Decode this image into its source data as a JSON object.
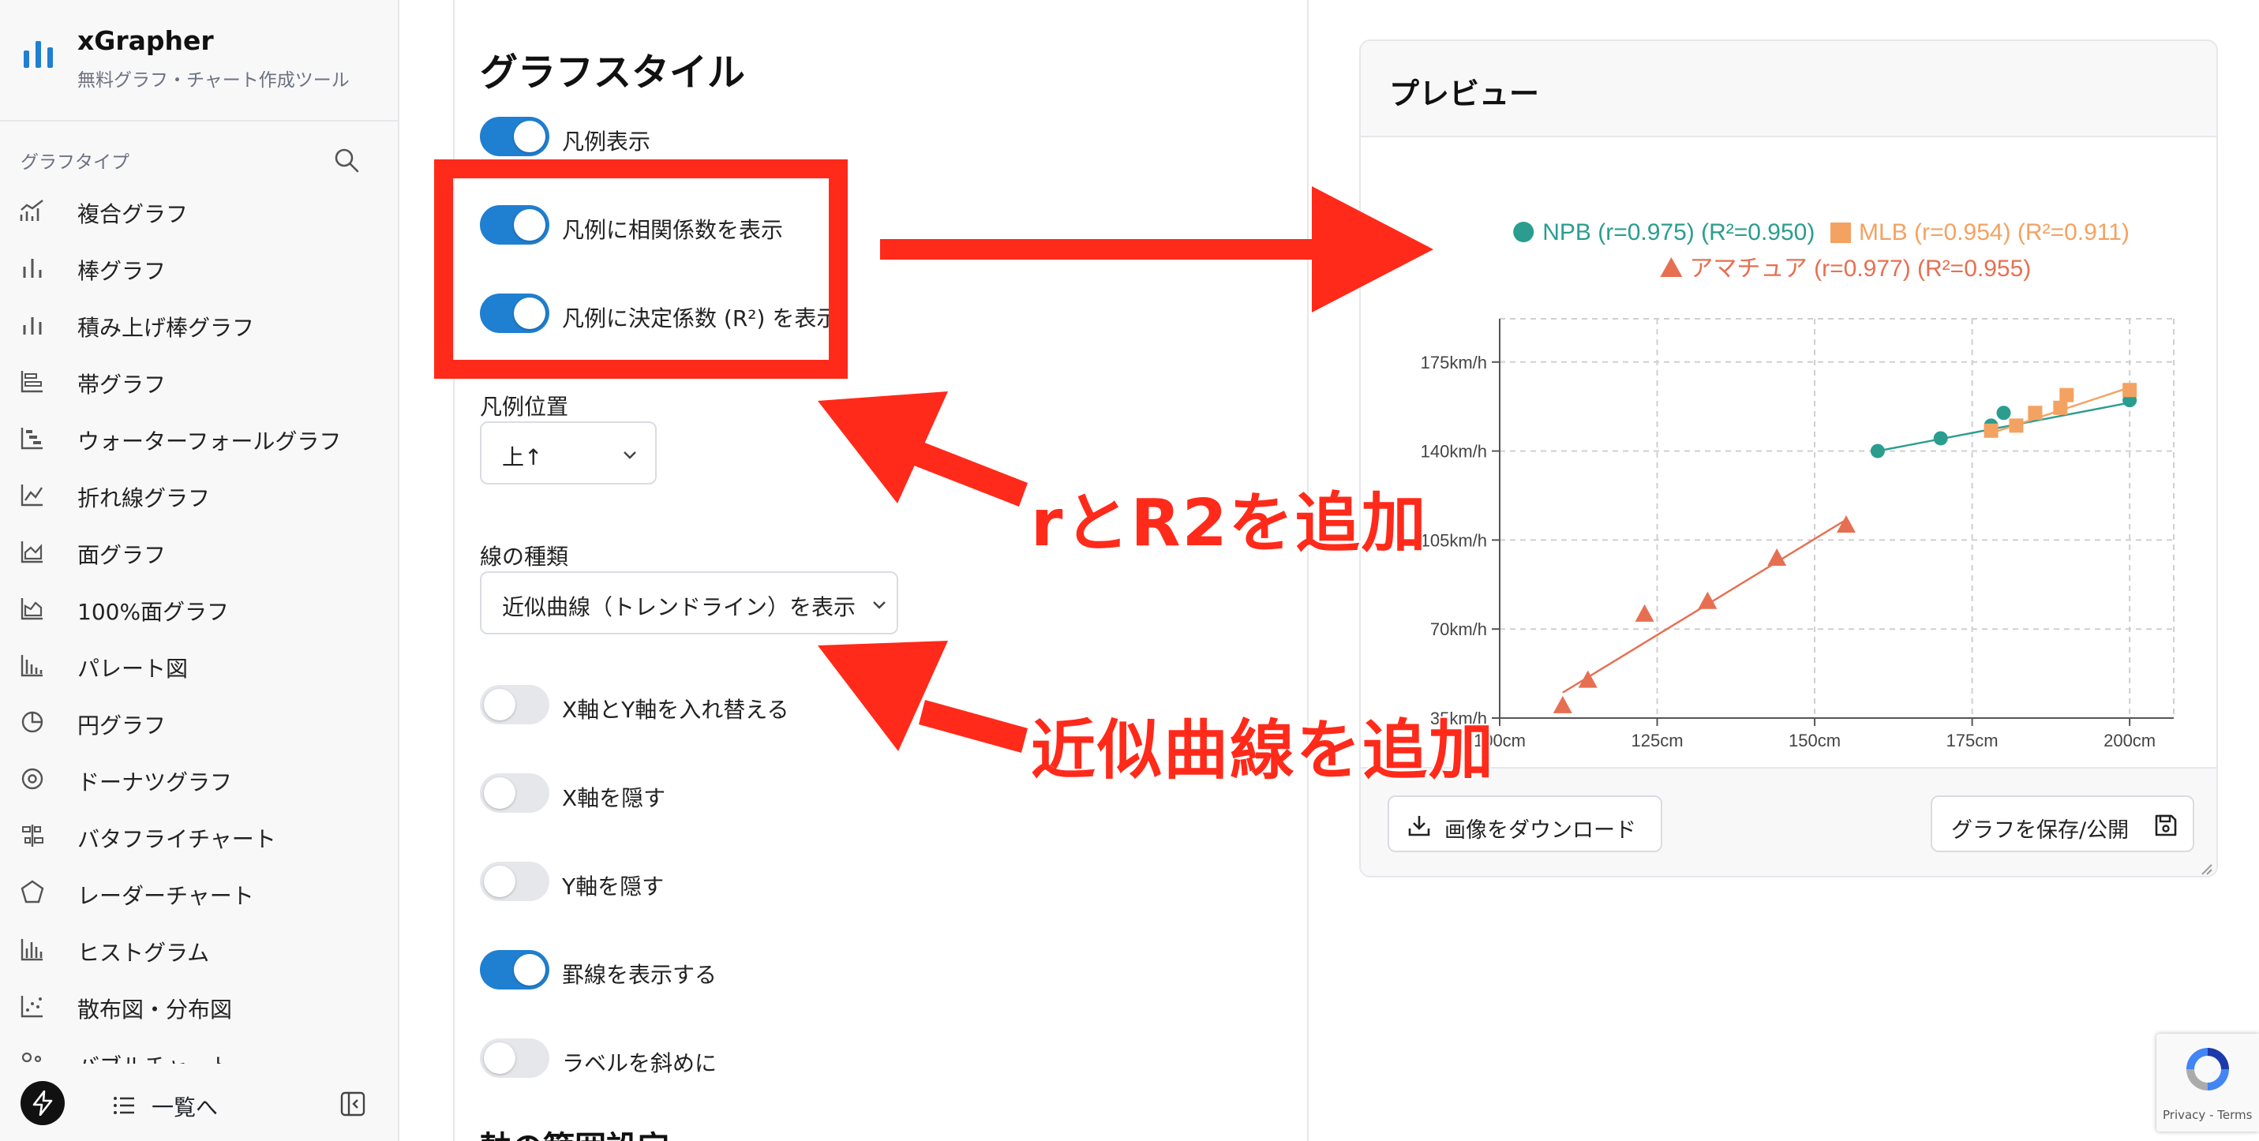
{
  "brand": {
    "name": "xGrapher",
    "subtitle": "無料グラフ・チャート作成ツール"
  },
  "sidebar": {
    "section_label": "グラフタイプ",
    "items": [
      {
        "label": "複合グラフ",
        "icon": "combo-chart-icon"
      },
      {
        "label": "棒グラフ",
        "icon": "bar-chart-icon"
      },
      {
        "label": "積み上げ棒グラフ",
        "icon": "stacked-bar-icon"
      },
      {
        "label": "帯グラフ",
        "icon": "horizontal-bar-icon"
      },
      {
        "label": "ウォーターフォールグラフ",
        "icon": "waterfall-icon"
      },
      {
        "label": "折れ線グラフ",
        "icon": "line-chart-icon"
      },
      {
        "label": "面グラフ",
        "icon": "area-chart-icon"
      },
      {
        "label": "100%面グラフ",
        "icon": "area-100-icon"
      },
      {
        "label": "パレート図",
        "icon": "pareto-icon"
      },
      {
        "label": "円グラフ",
        "icon": "pie-chart-icon"
      },
      {
        "label": "ドーナツグラフ",
        "icon": "donut-chart-icon"
      },
      {
        "label": "バタフライチャート",
        "icon": "butterfly-chart-icon"
      },
      {
        "label": "レーダーチャート",
        "icon": "radar-chart-icon"
      },
      {
        "label": "ヒストグラム",
        "icon": "histogram-icon"
      },
      {
        "label": "散布図・分布図",
        "icon": "scatter-icon"
      },
      {
        "label": "バブルチャート",
        "icon": "bubble-chart-icon"
      }
    ],
    "back_label": "一覧へ"
  },
  "settings": {
    "title": "グラフスタイル",
    "toggles_top": [
      {
        "label": "凡例表示",
        "on": true
      },
      {
        "label": "凡例に相関係数を表示",
        "on": true
      },
      {
        "label": "凡例に決定係数 (R²) を表示",
        "on": true
      }
    ],
    "legend_position": {
      "label": "凡例位置",
      "value": "上↑"
    },
    "line_type": {
      "label": "線の種類",
      "value": "近似曲線（トレンドライン）を表示"
    },
    "toggles_bottom": [
      {
        "label": "X軸とY軸を入れ替える",
        "on": false
      },
      {
        "label": "X軸を隠す",
        "on": false
      },
      {
        "label": "Y軸を隠す",
        "on": false
      },
      {
        "label": "罫線を表示する",
        "on": true
      },
      {
        "label": "ラベルを斜めに",
        "on": false
      }
    ],
    "next_section": "軸の範囲設定"
  },
  "preview": {
    "title": "プレビュー",
    "download_label": "画像をダウンロード",
    "save_label": "グラフを保存/公開"
  },
  "annotations": {
    "r2": "rとR2を追加",
    "trend": "近似曲線を追加",
    "color": "#ff2a1a"
  },
  "recaptcha": {
    "text": "Privacy - Terms"
  },
  "chart_data": {
    "type": "scatter",
    "x_ticks": [
      "100cm",
      "125cm",
      "150cm",
      "175cm",
      "200cm"
    ],
    "y_ticks": [
      "35km/h",
      "70km/h",
      "105km/h",
      "140km/h",
      "175km/h"
    ],
    "xlim": [
      100,
      207
    ],
    "ylim": [
      35,
      192
    ],
    "grid": true,
    "legend_position": "top",
    "trendline": true,
    "series": [
      {
        "name": "NPB",
        "legend": "NPB (r=0.975) (R²=0.950)",
        "marker": "circle",
        "color": "#2a9d8f",
        "points": [
          [
            160,
            140
          ],
          [
            170,
            145
          ],
          [
            178,
            150
          ],
          [
            180,
            155
          ],
          [
            200,
            160
          ]
        ],
        "trend": [
          [
            160,
            140
          ],
          [
            200,
            159
          ]
        ]
      },
      {
        "name": "MLB",
        "legend": "MLB (r=0.954) (R²=0.911)",
        "marker": "square",
        "color": "#f4a261",
        "points": [
          [
            178,
            148
          ],
          [
            182,
            150
          ],
          [
            185,
            155
          ],
          [
            189,
            157
          ],
          [
            190,
            162
          ],
          [
            200,
            164
          ]
        ],
        "trend": [
          [
            178,
            147
          ],
          [
            200,
            165
          ]
        ]
      },
      {
        "name": "アマチュア",
        "legend": "アマチュア (r=0.977) (R²=0.955)",
        "marker": "triangle",
        "color": "#e76f51",
        "points": [
          [
            110,
            40
          ],
          [
            114,
            50
          ],
          [
            123,
            76
          ],
          [
            133,
            81
          ],
          [
            144,
            98
          ],
          [
            155,
            111
          ]
        ],
        "trend": [
          [
            110,
            45
          ],
          [
            155,
            113
          ]
        ]
      }
    ]
  }
}
